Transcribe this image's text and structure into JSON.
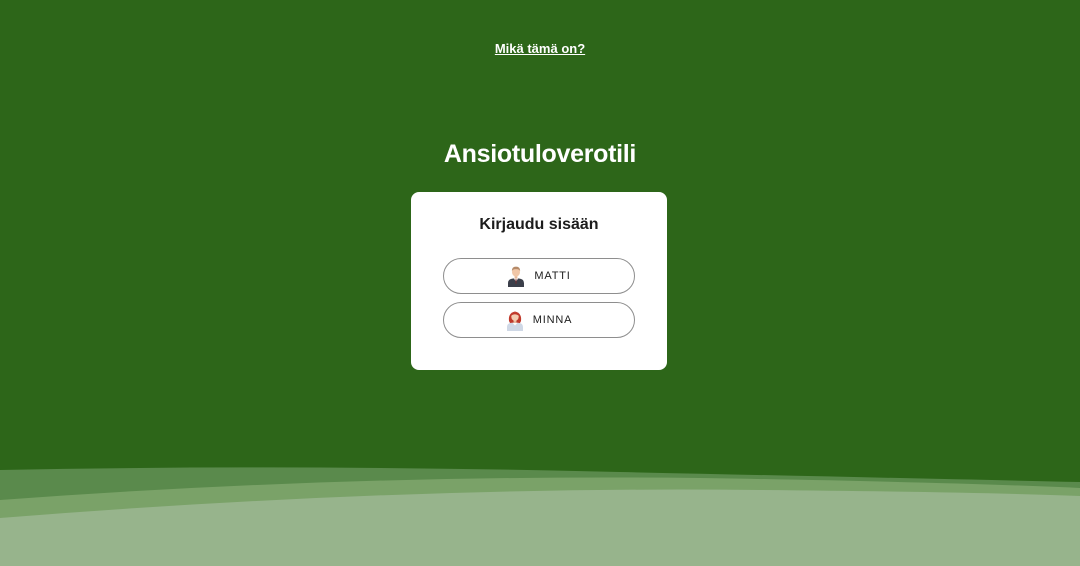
{
  "header": {
    "help_link_label": "Mikä tämä on?"
  },
  "app": {
    "title": "Ansiotuloverotili"
  },
  "login": {
    "heading": "Kirjaudu sisään",
    "users": [
      {
        "label": "MATTI",
        "avatar_icon": "man-avatar-icon"
      },
      {
        "label": "MINNA",
        "avatar_icon": "woman-avatar-icon"
      }
    ]
  },
  "colors": {
    "background": "#2d6619",
    "card": "#ffffff",
    "wave_dark": "#5a8a4c",
    "wave_mid": "#7aa268",
    "wave_light": "#97b48c"
  }
}
